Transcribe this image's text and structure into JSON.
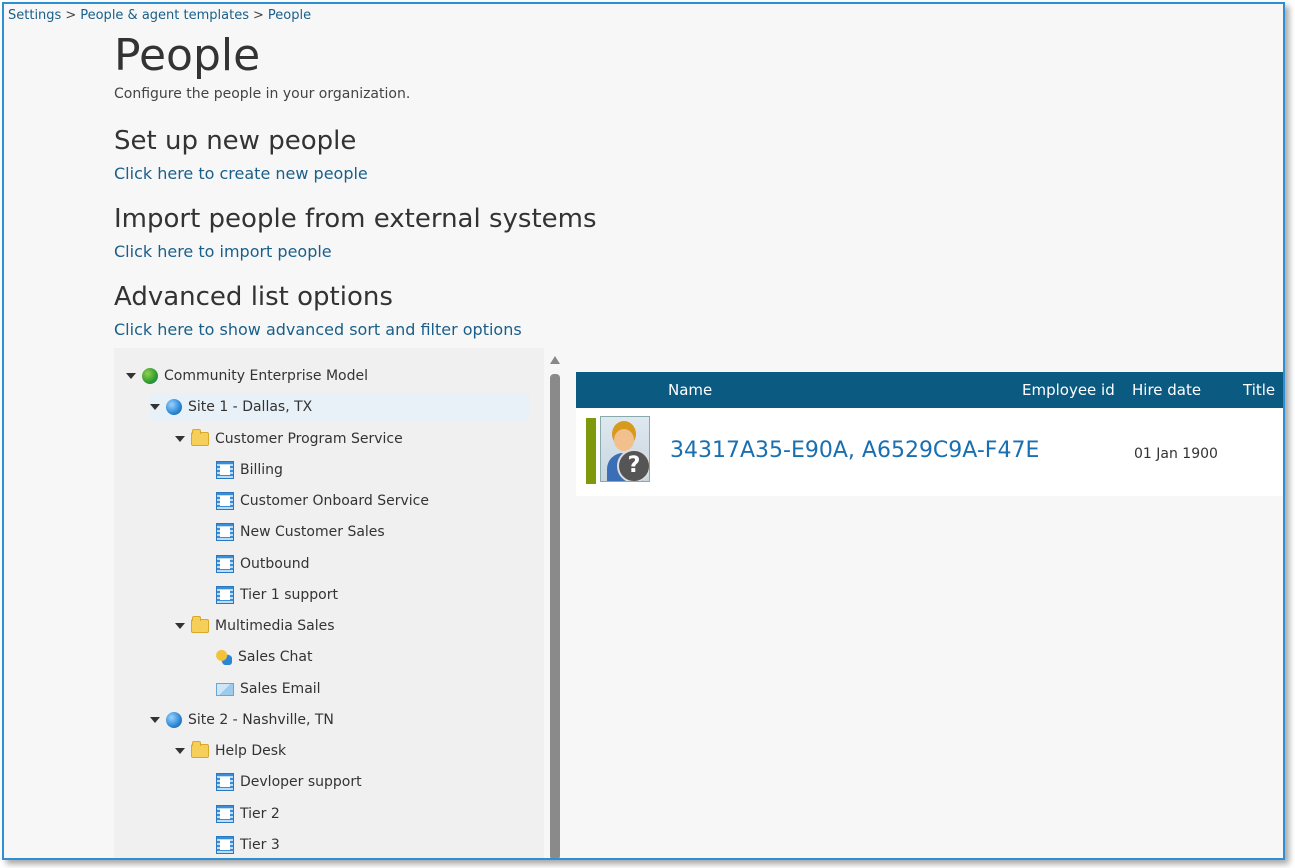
{
  "breadcrumb": [
    "Settings",
    "People & agent templates",
    "People"
  ],
  "page": {
    "title": "People",
    "subtitle": "Configure the people in your organization."
  },
  "sections": [
    {
      "heading": "Set up new people",
      "link": "Click here to create new people"
    },
    {
      "heading": "Import people from external systems",
      "link": "Click here to import people"
    },
    {
      "heading": "Advanced list options",
      "link": "Click here to show advanced sort and filter options"
    }
  ],
  "tree": [
    {
      "label": "Community Enterprise Model",
      "icon": "enterprise-globe-icon"
    },
    {
      "label": "Site 1 - Dallas, TX",
      "icon": "site-globe-icon"
    },
    {
      "label": "Customer Program Service",
      "icon": "folder-icon"
    },
    {
      "label": "Billing",
      "icon": "queue-icon"
    },
    {
      "label": "Customer Onboard Service",
      "icon": "queue-icon"
    },
    {
      "label": "New Customer Sales",
      "icon": "queue-icon"
    },
    {
      "label": "Outbound",
      "icon": "queue-icon"
    },
    {
      "label": "Tier 1 support",
      "icon": "queue-icon"
    },
    {
      "label": "Multimedia Sales",
      "icon": "folder-icon"
    },
    {
      "label": "Sales Chat",
      "icon": "chat-icon"
    },
    {
      "label": "Sales Email",
      "icon": "email-icon"
    },
    {
      "label": "Site 2 - Nashville, TN",
      "icon": "site-globe-icon"
    },
    {
      "label": "Help Desk",
      "icon": "folder-icon"
    },
    {
      "label": "Devloper support",
      "icon": "queue-icon"
    },
    {
      "label": "Tier 2",
      "icon": "queue-icon"
    },
    {
      "label": "Tier 3",
      "icon": "queue-icon"
    }
  ],
  "grid": {
    "columns": [
      "Name",
      "Employee id",
      "Hire date",
      "Title"
    ],
    "rows": [
      {
        "name": "34317A35-E90A, A6529C9A-F47E",
        "employee_id": "",
        "hire_date": "01 Jan 1900",
        "title": "",
        "status_color": "#7e9a0c"
      }
    ]
  },
  "colors": {
    "accent": "#2e8fd3",
    "header": "#0b5a82",
    "link": "#1a5f8a"
  }
}
